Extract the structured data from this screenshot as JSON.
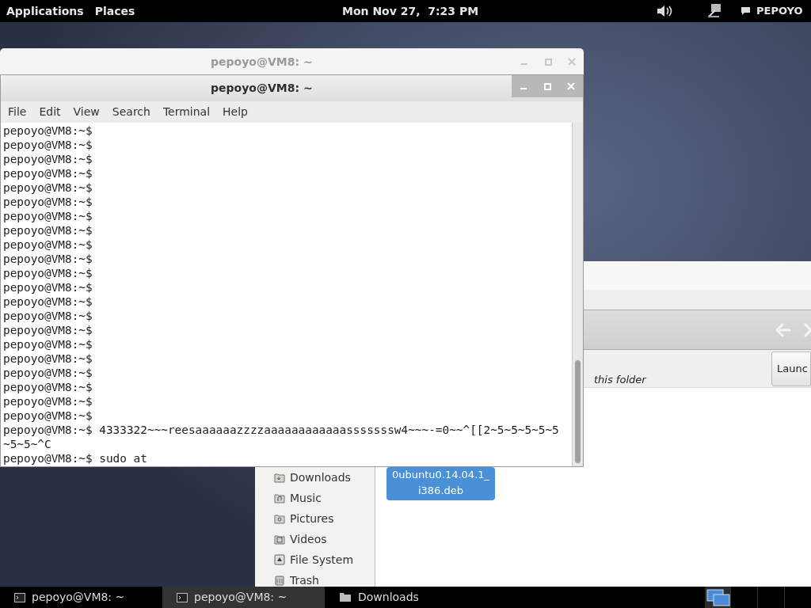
{
  "top_bar": {
    "menus": [
      "Applications",
      "Places"
    ],
    "clock": "Mon Nov 27,  7:23 PM",
    "user": "PEPOYO"
  },
  "back_terminal": {
    "title": "pepoyo@VM8: ~",
    "active": false
  },
  "file_manager": {
    "notice": "this folder",
    "button": "Launc",
    "sidebar": [
      {
        "label": "Downloads",
        "kind": "downloads"
      },
      {
        "label": "Music",
        "kind": "music"
      },
      {
        "label": "Pictures",
        "kind": "pictures"
      },
      {
        "label": "Videos",
        "kind": "videos"
      },
      {
        "label": "File System",
        "kind": "drive"
      },
      {
        "label": "Trash",
        "kind": "trash"
      }
    ],
    "file": {
      "lines": [
        "0ubuntu0.14.04.1_",
        "i386.deb"
      ],
      "selected": true
    }
  },
  "terminal": {
    "title": "pepoyo@VM8: ~",
    "active": true,
    "menu": [
      "File",
      "Edit",
      "View",
      "Search",
      "Terminal",
      "Help"
    ],
    "lines": [
      "pepoyo@VM8:~$",
      "pepoyo@VM8:~$",
      "pepoyo@VM8:~$",
      "pepoyo@VM8:~$",
      "pepoyo@VM8:~$",
      "pepoyo@VM8:~$",
      "pepoyo@VM8:~$",
      "pepoyo@VM8:~$",
      "pepoyo@VM8:~$",
      "pepoyo@VM8:~$",
      "pepoyo@VM8:~$",
      "pepoyo@VM8:~$",
      "pepoyo@VM8:~$",
      "pepoyo@VM8:~$",
      "pepoyo@VM8:~$",
      "pepoyo@VM8:~$",
      "pepoyo@VM8:~$",
      "pepoyo@VM8:~$",
      "pepoyo@VM8:~$",
      "pepoyo@VM8:~$",
      "pepoyo@VM8:~$",
      "pepoyo@VM8:~$ 4333322~~~reesaaaaaazzzzaaaaaaaaaaaasssssssw4~~~-=0~~^[[2~5~5~5~5~5",
      "~5~5~^C",
      "pepoyo@VM8:~$ sudo at"
    ]
  },
  "taskbar": [
    {
      "label": "pepoyo@VM8: ~",
      "kind": "terminal",
      "selected": false
    },
    {
      "label": "pepoyo@VM8: ~",
      "kind": "terminal",
      "selected": true
    },
    {
      "label": "Downloads",
      "kind": "folder",
      "selected": false
    }
  ]
}
